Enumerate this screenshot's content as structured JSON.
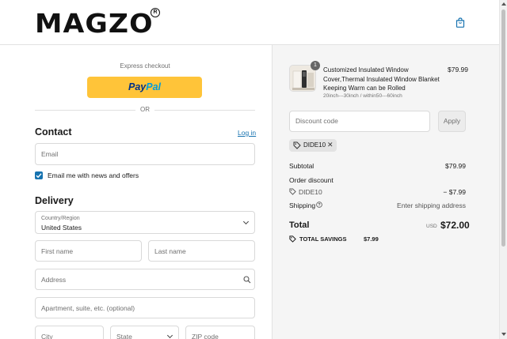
{
  "header": {
    "logo_text": "MAGZO",
    "logo_mark": "R",
    "cart_icon": "shopping-bag-icon"
  },
  "checkout": {
    "express_label": "Express checkout",
    "paypal_part1": "Pay",
    "paypal_part2": "Pal",
    "or_label": "OR",
    "contact": {
      "title": "Contact",
      "login_link": "Log in",
      "email_placeholder": "Email",
      "newsletter_label": "Email me with news and offers",
      "newsletter_checked": true
    },
    "delivery": {
      "title": "Delivery",
      "country_label": "Country/Region",
      "country_value": "United States",
      "first_name_placeholder": "First name",
      "last_name_placeholder": "Last name",
      "address_placeholder": "Address",
      "apartment_placeholder": "Apartment, suite, etc. (optional)",
      "city_placeholder": "City",
      "state_placeholder": "State",
      "zip_placeholder": "ZIP code"
    }
  },
  "summary": {
    "product": {
      "quantity": "1",
      "name": "Customized Insulated Window Cover,Thermal Insulated Window Blanket Keeping Warm can be Rolled",
      "variant": "20inch---30inch / within50---60inch",
      "price": "$79.99"
    },
    "discount_placeholder": "Discount code",
    "apply_label": "Apply",
    "applied_code": "DIDE10",
    "subtotal_label": "Subtotal",
    "subtotal_value": "$79.99",
    "order_discount_label": "Order discount",
    "discount_code_label": "DIDE10",
    "discount_value": "− $7.99",
    "shipping_label": "Shipping",
    "shipping_value": "Enter shipping address",
    "total_label": "Total",
    "currency": "USD",
    "total_value": "$72.00",
    "savings_label": "TOTAL SAVINGS",
    "savings_value": "$7.99"
  },
  "colors": {
    "accent": "#1773b0",
    "paypal_yellow": "#ffc439",
    "summary_bg": "#f5f5f5"
  }
}
